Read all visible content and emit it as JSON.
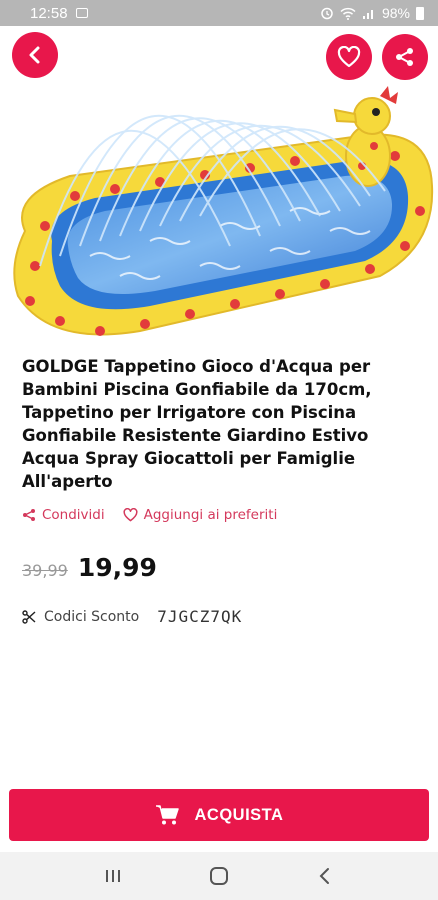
{
  "status_bar": {
    "time": "12:58",
    "battery": "98%"
  },
  "product": {
    "title": "GOLDGE Tappetino Gioco d'Acqua per Bambini Piscina Gonfiabile da 170cm, Tappetino per Irrigatore con Piscina Gonfiabile Resistente Giardino Estivo Acqua Spray Giocattoli per Famiglie All'aperto",
    "old_price": "39,99",
    "price": "19,99"
  },
  "actions": {
    "share_label": "Condividi",
    "favorites_label": "Aggiungi ai preferiti"
  },
  "coupon": {
    "label": "Codici Sconto",
    "code": "7JGCZ7QK"
  },
  "buy": {
    "label": "ACQUISTA"
  },
  "colors": {
    "accent": "#e8174b",
    "action_text": "#d4395c"
  },
  "icons": [
    "back-arrow-icon",
    "heart-icon",
    "share-icon",
    "scissors-icon",
    "cart-icon",
    "recent-apps-icon",
    "home-icon",
    "nav-back-icon"
  ]
}
